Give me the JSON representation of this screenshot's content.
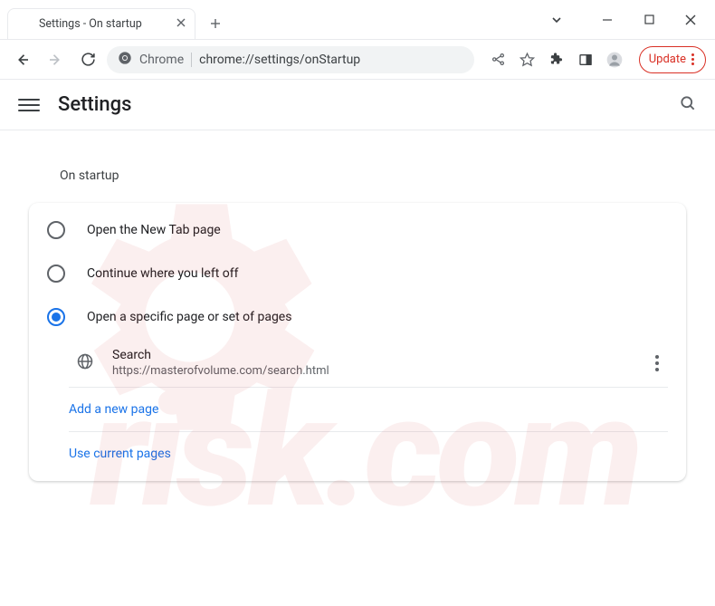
{
  "window": {
    "tab_title": "Settings - On startup"
  },
  "toolbar": {
    "url_scheme": "Chrome",
    "url_path": "chrome://settings/onStartup",
    "update_label": "Update"
  },
  "header": {
    "title": "Settings"
  },
  "section": {
    "title": "On startup",
    "options": [
      {
        "label": "Open the New Tab page",
        "selected": false
      },
      {
        "label": "Continue where you left off",
        "selected": false
      },
      {
        "label": "Open a specific page or set of pages",
        "selected": true
      }
    ],
    "pages": [
      {
        "name": "Search",
        "url": "https://masterofvolume.com/search.html"
      }
    ],
    "add_new_page": "Add a new page",
    "use_current_pages": "Use current pages"
  }
}
